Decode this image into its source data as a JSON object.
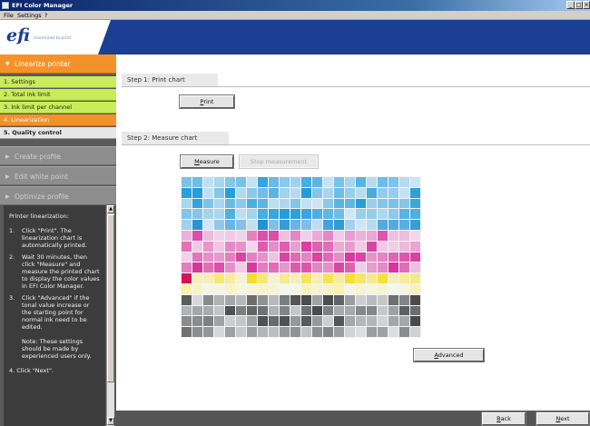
{
  "window": {
    "title": "EFI Color Manager",
    "controls": [
      "_",
      "□",
      "×"
    ]
  },
  "menu": [
    "File",
    "Settings",
    "?"
  ],
  "brand": {
    "logo": "efi",
    "tagline": "(comm)ed to print"
  },
  "sidebar": {
    "linearize_group": "Linearize printer",
    "steps": [
      "1. Settings",
      "2. Total ink limit",
      "3. Ink limit per channel",
      "4. Linearization",
      "5. Quality control"
    ],
    "current_step_index": 3,
    "disabled_groups": [
      "Create profile",
      "Edit white point",
      "Optimize profile"
    ],
    "help": {
      "title": "Printer linearization:",
      "items": [
        {
          "num": "1.",
          "text": "Click \"Print\". The linearization chart is automatically printed."
        },
        {
          "num": "2.",
          "text": "Wait 30 minutes, then click \"Measure\" and measure the printed chart to display the color values in EFI Color Manager."
        },
        {
          "num": "3.",
          "text": "Click \"Advanced\" if the tonal value increase or the starting point for normal ink need to be edited."
        }
      ],
      "note": "Note: These settings should be made by experienced users only.",
      "cutoff_line": "4. Click \"Next\"."
    }
  },
  "main": {
    "step1_label": "Step 1: Print chart",
    "print_button": "Print",
    "step2_label": "Step 2: Measure chart",
    "measure_button": "Measure",
    "stop_button": "Stop measurement",
    "advanced_button": "Advanced"
  },
  "footer": {
    "back_button": "Back",
    "next_button": "Next"
  },
  "colors": {
    "header_blue": "#1a3f93",
    "accent_orange": "#f4922a",
    "step_green": "#c8ec5a",
    "sidebar_dark": "#5a5a5a"
  },
  "icons": [
    "app-icon",
    "minimize-icon",
    "maximize-icon",
    "close-icon",
    "triangle-down-icon",
    "triangle-right-icon",
    "scroll-up-icon",
    "scroll-down-icon"
  ]
}
